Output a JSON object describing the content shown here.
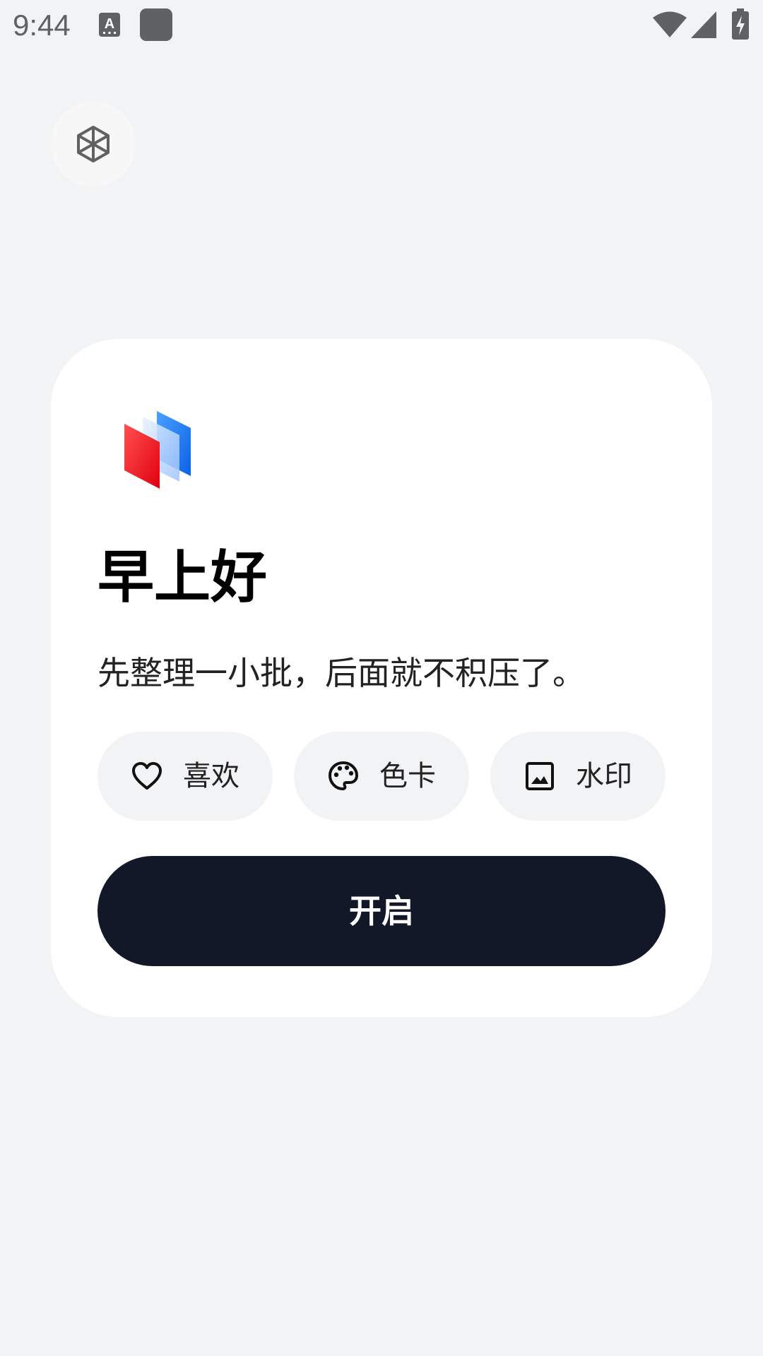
{
  "status_bar": {
    "time": "9:44",
    "icons": [
      "keyboard-a-icon",
      "app-square-icon",
      "wifi-icon",
      "signal-icon",
      "battery-charging-icon"
    ],
    "icon_color": "#5f6163"
  },
  "top_button": {
    "icon": "hexagon-cube-icon"
  },
  "card": {
    "logo": "layered-cards-logo",
    "greeting": "早上好",
    "subtitle": "先整理一小批，后面就不积压了。",
    "chips": [
      {
        "icon": "heart-icon",
        "label": "喜欢"
      },
      {
        "icon": "palette-icon",
        "label": "色卡"
      },
      {
        "icon": "image-icon",
        "label": "水印"
      }
    ],
    "primary_button": {
      "label": "开启"
    }
  },
  "colors": {
    "page_background": "#f2f3f5",
    "card_background": "#ffffff",
    "chip_background": "#f2f3f5",
    "primary_button_background": "#131828",
    "primary_button_text": "#ffffff",
    "logo_red": "#ff2a2a",
    "logo_blue": "#1e7bff"
  }
}
